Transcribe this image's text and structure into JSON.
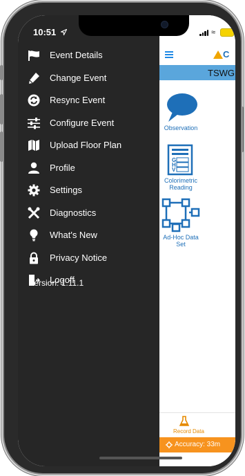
{
  "status": {
    "time": "10:51"
  },
  "header": {
    "logo_text": "C"
  },
  "event_bar": {
    "text": "TSWG D"
  },
  "tiles": [
    {
      "label": "Observation"
    },
    {
      "label": "Colorimetric Reading"
    },
    {
      "label": "Ad-Hoc Data Set"
    }
  ],
  "bottom_tab": {
    "label": "Record Data"
  },
  "accuracy": {
    "text": "Accuracy: 33m"
  },
  "menu": {
    "items": [
      {
        "label": "Event Details",
        "icon": "flag-icon"
      },
      {
        "label": "Change Event",
        "icon": "pencil-icon"
      },
      {
        "label": "Resync Event",
        "icon": "sync-icon"
      },
      {
        "label": "Configure Event",
        "icon": "sliders-icon"
      },
      {
        "label": "Upload Floor Plan",
        "icon": "map-icon"
      },
      {
        "label": "Profile",
        "icon": "person-icon"
      },
      {
        "label": "Settings",
        "icon": "gear-icon"
      },
      {
        "label": "Diagnostics",
        "icon": "tools-icon"
      },
      {
        "label": "What's New",
        "icon": "lightbulb-icon"
      },
      {
        "label": "Privacy Notice",
        "icon": "lock-icon"
      },
      {
        "label": "Logoff",
        "icon": "logoff-icon"
      }
    ],
    "version": "Version: 1.11.1"
  },
  "colors": {
    "drawer_bg": "#262626",
    "accent_blue": "#1e88e5",
    "event_bar": "#5aa6dc",
    "accuracy_bar": "#f7931e"
  }
}
